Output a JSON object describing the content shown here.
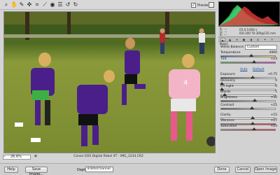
{
  "toolbar": {
    "tools": [
      {
        "name": "zoom-tool-icon",
        "glyph": "⌕"
      },
      {
        "name": "hand-tool-icon",
        "glyph": "✋"
      },
      {
        "name": "white-balance-tool-icon",
        "glyph": "✎"
      },
      {
        "name": "color-sampler-tool-icon",
        "glyph": "✜"
      },
      {
        "name": "crop-tool-icon",
        "glyph": "⌗"
      },
      {
        "name": "straighten-tool-icon",
        "glyph": "⟋"
      },
      {
        "name": "red-eye-tool-icon",
        "glyph": "◉"
      },
      {
        "name": "preferences-icon",
        "glyph": "☰"
      },
      {
        "name": "rotate-left-icon",
        "glyph": "↺"
      },
      {
        "name": "rotate-right-icon",
        "glyph": "↻"
      }
    ],
    "preview_label": "Preview",
    "preview_checked": "✓"
  },
  "status": {
    "zoom_value": "26.6%",
    "zoom_minus": "–",
    "zoom_plus": "+",
    "camera_info": "Canon EOS Digital Rebel XT  -  IMG_1234.CR2"
  },
  "readout": {
    "r_label": "R:",
    "r_value": "---",
    "g_label": "G:",
    "g_value": "---",
    "b_label": "B:",
    "b_value": "---",
    "exposure_info": "f/5.6   1/400 s",
    "iso_info": "ISO 200   70-300@135 mm"
  },
  "panel": {
    "section_title": "Basic",
    "white_balance_label": "White Balance:",
    "white_balance_value": "Custom",
    "auto_label": "Auto",
    "default_label": "Default",
    "sliders": [
      {
        "label": "Temperature",
        "value": "4900",
        "pos": 0.55,
        "gradient": "linear-gradient(90deg,#3a5fd0,#f2e24a)"
      },
      {
        "label": "Tint",
        "value": "+23",
        "pos": 0.6,
        "gradient": "linear-gradient(90deg,#3cb043,#d03ad0)"
      },
      {
        "label": "Exposure",
        "value": "+0.75",
        "pos": 0.58,
        "gradient": "linear-gradient(90deg,#444,#fff)"
      },
      {
        "label": "Recovery",
        "value": "0",
        "pos": 0.0,
        "gradient": "linear-gradient(90deg,#fff,#fff)"
      },
      {
        "label": "Fill Light",
        "value": "0",
        "pos": 0.0,
        "gradient": "linear-gradient(90deg,#fff,#fff)"
      },
      {
        "label": "Blacks",
        "value": "5",
        "pos": 0.05,
        "gradient": "linear-gradient(90deg,#fff,#fff)"
      },
      {
        "label": "Brightness",
        "value": "+50",
        "pos": 0.62,
        "gradient": "linear-gradient(90deg,#444,#fff)"
      },
      {
        "label": "Contrast",
        "value": "+25",
        "pos": 0.56,
        "gradient": "linear-gradient(90deg,#444,#fff)"
      },
      {
        "label": "Clarity",
        "value": "+15",
        "pos": 0.58,
        "gradient": "linear-gradient(90deg,#fff,#fff)"
      },
      {
        "label": "Vibrance",
        "value": "+17",
        "pos": 0.58,
        "gradient": "linear-gradient(90deg,#888,#e33)"
      },
      {
        "label": "Saturation",
        "value": "+23",
        "pos": 0.6,
        "gradient": "linear-gradient(90deg,#888,#e33)"
      }
    ],
    "tabs": [
      "◐",
      "▲",
      "≡",
      "▣",
      "◑",
      "◎",
      "✦",
      "☼"
    ]
  },
  "bottom": {
    "help_label": "Help",
    "save_image_label": "Save Image...",
    "depth_label": "Depth:",
    "depth_value": "8 Bits/Channel",
    "done_label": "Done",
    "cancel_label": "Cancel",
    "open_image_label": "Open Image"
  },
  "colors": {
    "histogram_red": "#e23b3b",
    "histogram_green": "#3ee05a",
    "histogram_blue": "#3b77ff",
    "field_green": "#7a8c35",
    "jersey_purple": "#4b1f8a",
    "jersey_pink": "#f4b4c8"
  }
}
